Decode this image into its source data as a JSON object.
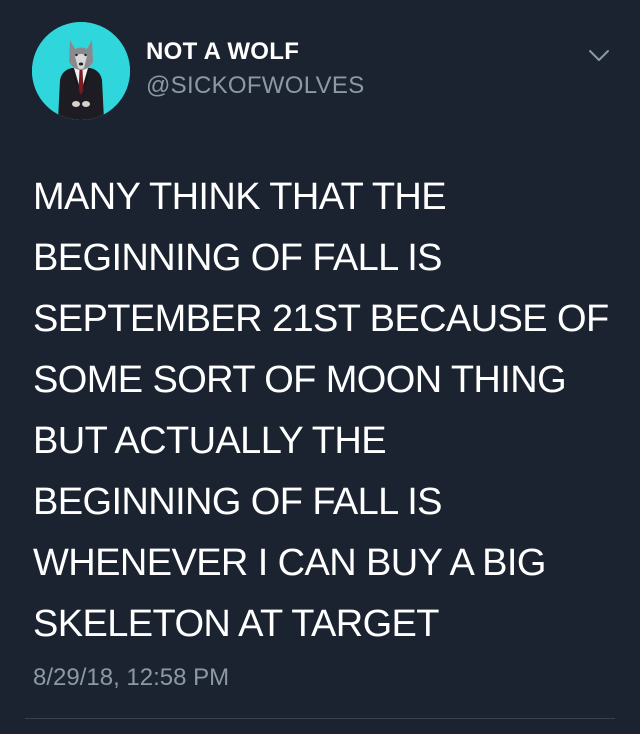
{
  "user": {
    "display_name": "NOT A WOLF",
    "handle": "@SICKOFWOLVES",
    "avatar_icon": "wolf-in-suit-avatar",
    "avatar_bg": "#2fd6dc"
  },
  "tweet": {
    "lines": [
      "MANY THINK THAT THE",
      "BEGINNING OF FALL IS",
      "SEPTEMBER 21ST BECAUSE OF",
      "SOME SORT OF MOON THING",
      "BUT ACTUALLY THE",
      "BEGINNING OF FALL IS",
      "WHENEVER I CAN BUY A BIG",
      "SKELETON AT TARGET"
    ],
    "timestamp": "8/29/18, 12:58 PM"
  },
  "menu": {
    "icon": "chevron-down-icon"
  },
  "theme": {
    "background": "#1b2330",
    "text": "#ffffff",
    "secondary_text": "#8b98a5",
    "divider": "#38444d"
  }
}
